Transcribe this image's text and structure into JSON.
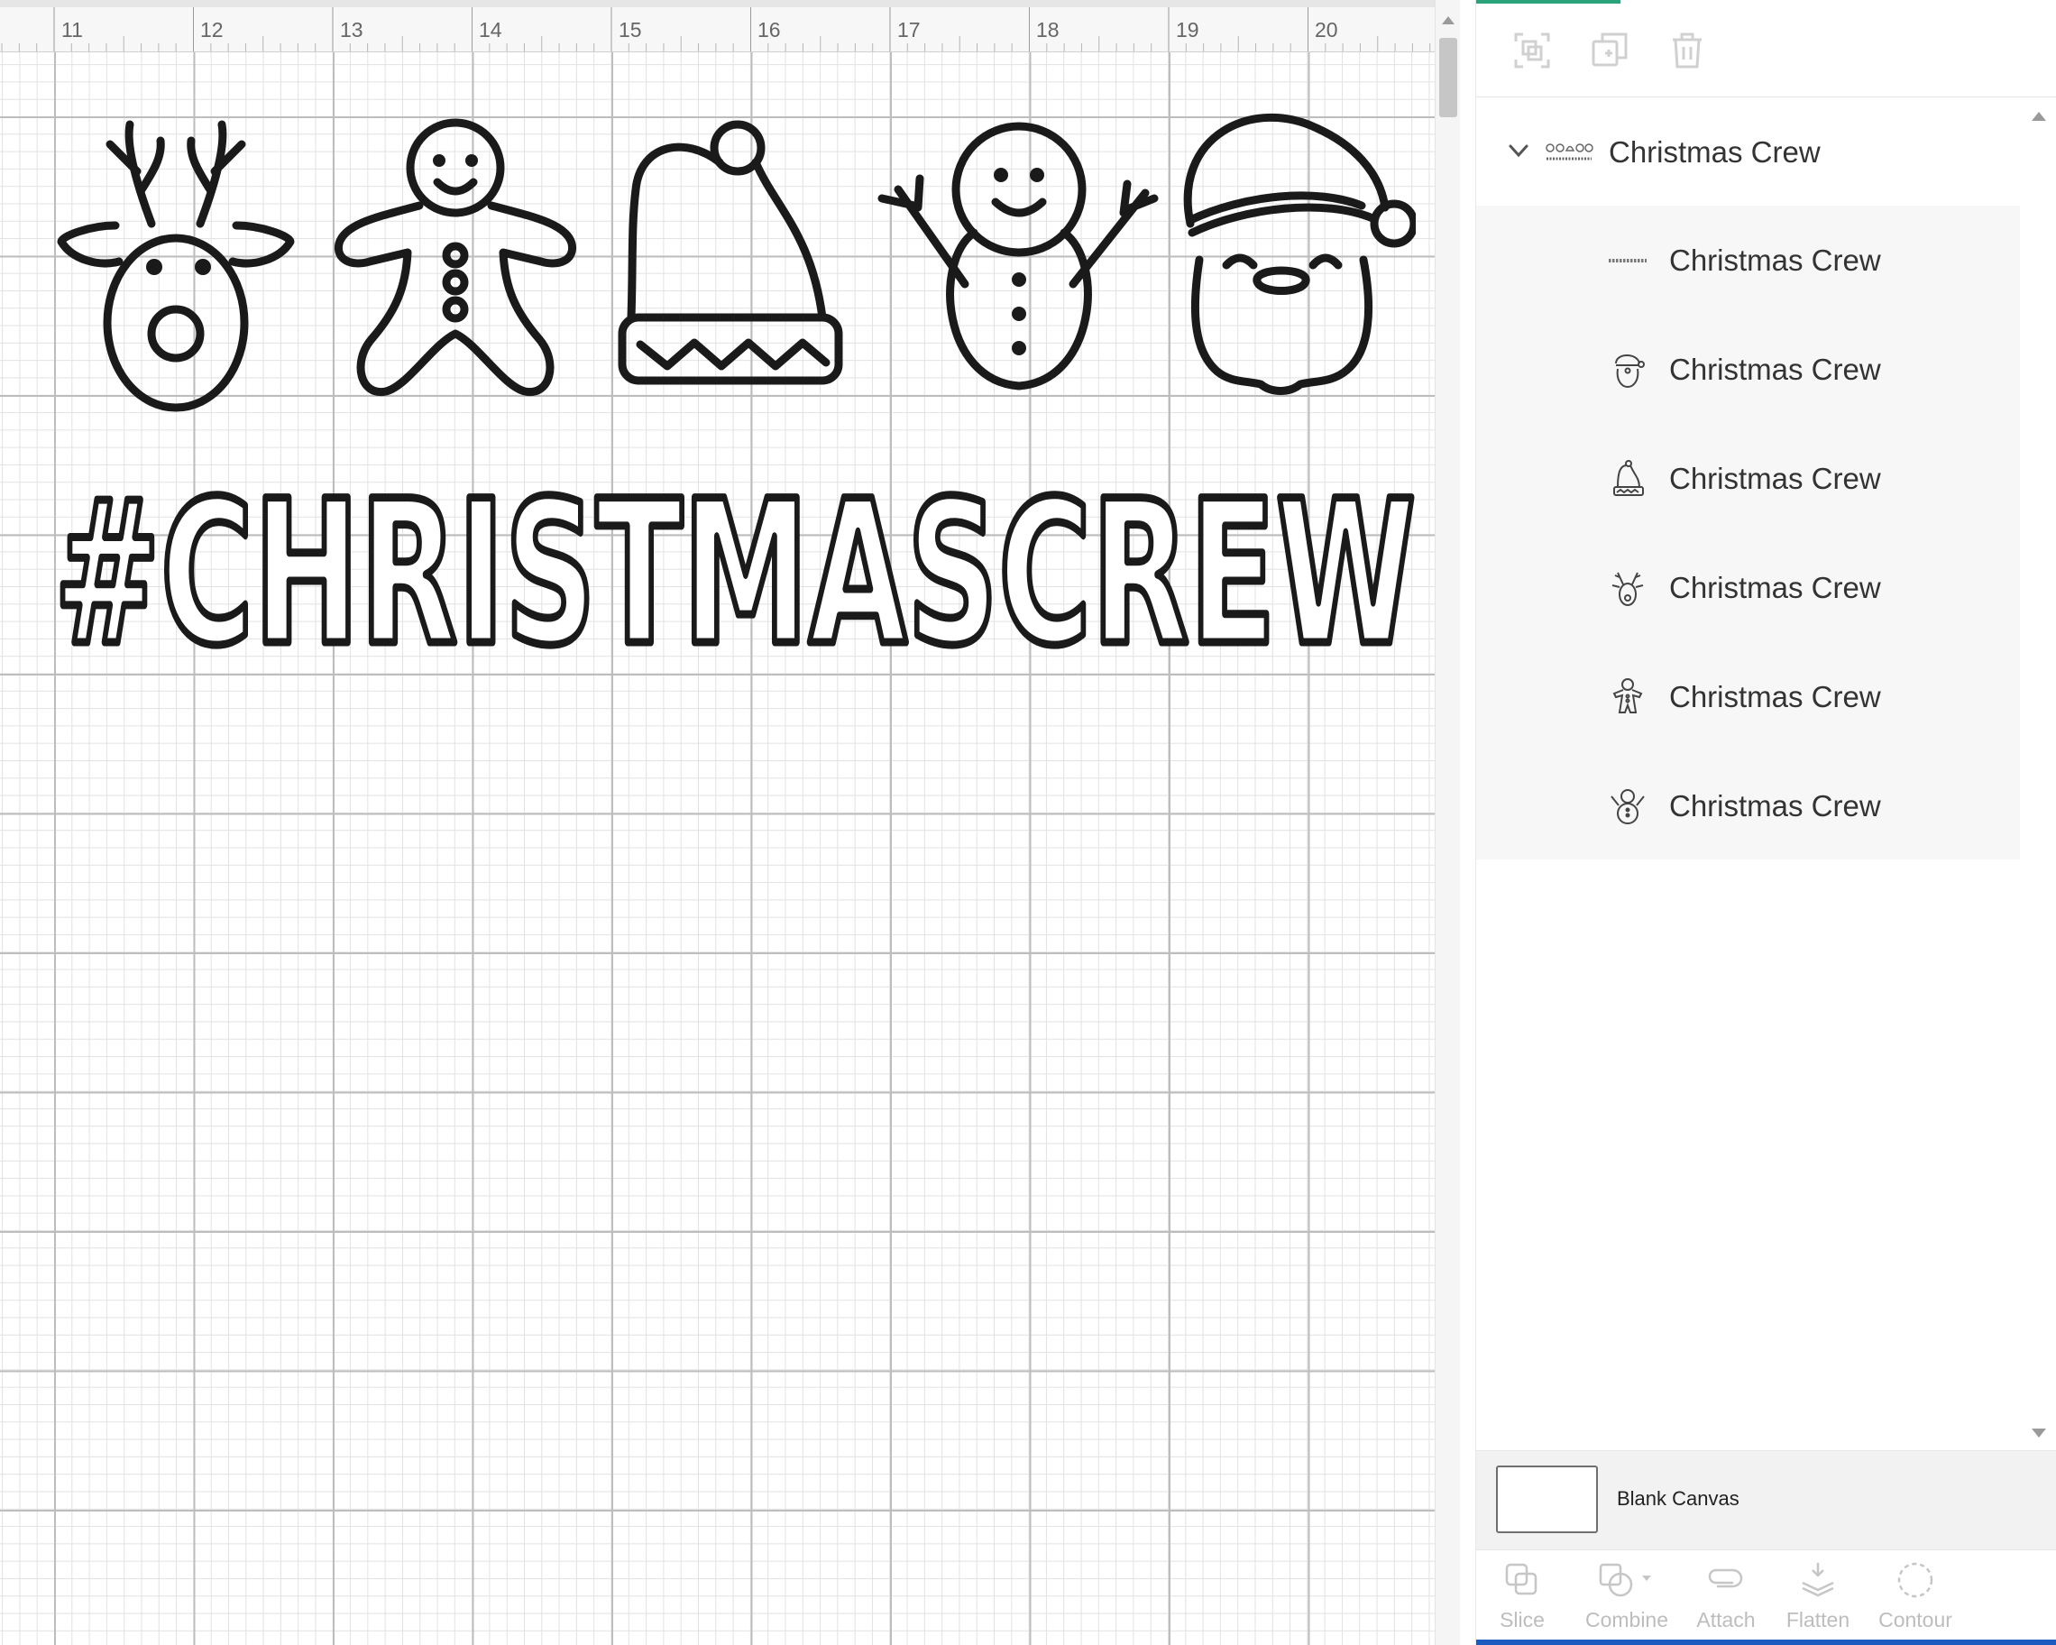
{
  "ruler": {
    "labels": [
      "11",
      "12",
      "13",
      "14",
      "15",
      "16",
      "17",
      "18",
      "19",
      "20"
    ]
  },
  "design": {
    "text": "#CHRISTMASCREW",
    "icons": [
      "reindeer-icon",
      "gingerbread-man-icon",
      "santa-hat-icon",
      "snowman-icon",
      "santa-face-icon"
    ],
    "ink_color": "#1a1a1a"
  },
  "layers": {
    "group": {
      "label": "Christmas Crew",
      "expanded": true
    },
    "children": [
      {
        "label": "Christmas Crew",
        "thumb": "text-thumb"
      },
      {
        "label": "Christmas Crew",
        "thumb": "santa-face-thumb"
      },
      {
        "label": "Christmas Crew",
        "thumb": "santa-hat-thumb"
      },
      {
        "label": "Christmas Crew",
        "thumb": "reindeer-thumb"
      },
      {
        "label": "Christmas Crew",
        "thumb": "gingerbread-thumb"
      },
      {
        "label": "Christmas Crew",
        "thumb": "snowman-thumb"
      }
    ]
  },
  "canvas": {
    "label": "Blank Canvas"
  },
  "actions": [
    "Slice",
    "Combine",
    "Attach",
    "Flatten",
    "Contour"
  ],
  "colors": {
    "accent_green": "#2aa37a",
    "accent_blue": "#1b5bbf",
    "disabled": "#bdbdbd"
  }
}
